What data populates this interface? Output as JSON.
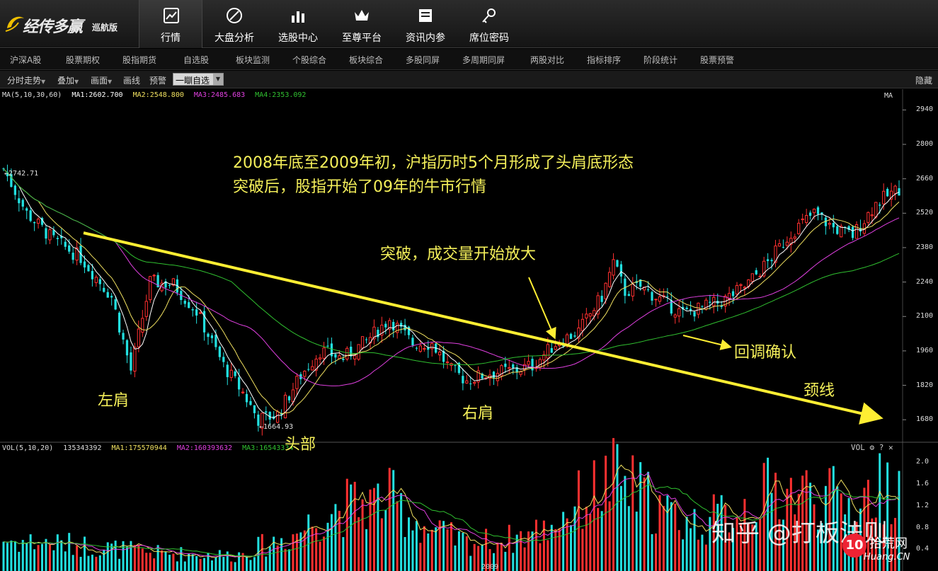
{
  "app": {
    "logo_name": "经传多赢",
    "logo_edition": "巡航版"
  },
  "nav": [
    {
      "label": "行情",
      "icon": "chart-trend-icon",
      "active": true
    },
    {
      "label": "大盘分析",
      "icon": "compass-icon",
      "active": false
    },
    {
      "label": "选股中心",
      "icon": "bar-chart-icon",
      "active": false
    },
    {
      "label": "至尊平台",
      "icon": "crown-icon",
      "active": false
    },
    {
      "label": "资讯内参",
      "icon": "news-icon",
      "active": false
    },
    {
      "label": "席位密码",
      "icon": "key-icon",
      "active": false
    }
  ],
  "menu": [
    "沪深A股",
    "股票期权",
    "股指期货",
    "自选股",
    "板块监测",
    "个股综合",
    "板块综合",
    "多股同屏",
    "多周期同屏",
    "两股对比",
    "指标排序",
    "阶段统计",
    "股票预警"
  ],
  "toolbar": {
    "intraday": "分时走势",
    "overlay": "叠加",
    "draw": "画面",
    "line": "画线",
    "alert": "预警",
    "combo_value": "一瞓自选",
    "hide": "隐藏"
  },
  "ma_legend": {
    "head": "MA(5,10,30,60)",
    "ma1": "MA1:2602.700",
    "ma2": "MA2:2548.800",
    "ma3": "MA3:2485.683",
    "ma4": "MA4:2353.092",
    "tag": "MA"
  },
  "vol_legend": {
    "head": "VOL(5,10,20)",
    "value": "135343392",
    "ma1": "MA1:175570944",
    "ma2": "MA2:160393632",
    "ma3": "MA3:16543334",
    "tools": "VOL ⚙ ? ✕"
  },
  "price_labels": {
    "high": "2742.71",
    "low": "1664.93"
  },
  "date_tick": "2009",
  "annotations": {
    "title1": "2008年底至2009年初，沪指历时5个月形成了头肩底形态",
    "title2": "突破后，股指开始了09年的牛市行情",
    "breakout": "突破，成交量开始放大",
    "left_shoulder": "左肩",
    "head": "头部",
    "right_shoulder": "右肩",
    "retest": "回调确认",
    "neckline": "颈线"
  },
  "watermark": "知乎 @打板法则",
  "brand": {
    "num": "10",
    "name": "拾荒网",
    "url": "Huang.CN"
  },
  "colors": {
    "up": "#ff3030",
    "down": "#22e0e0",
    "ma1": "#ffffff",
    "ma2": "#f0e060",
    "ma3": "#e040e0",
    "ma4": "#30c030",
    "annotation": "#f5f05a"
  },
  "chart_data": {
    "type": "candlestick",
    "price_axis": {
      "ticks": [
        2940,
        2800,
        2660,
        2520,
        2380,
        2240,
        2100,
        1960,
        1820,
        1680
      ],
      "range": [
        1600,
        2990
      ]
    },
    "volume_axis": {
      "ticks": [
        2.0,
        1.6,
        1.2,
        0.8,
        0.4
      ],
      "range": [
        0,
        2.2
      ]
    },
    "price_anchors": [
      [
        0,
        2700
      ],
      [
        6,
        2520
      ],
      [
        13,
        2410
      ],
      [
        20,
        2340
      ],
      [
        28,
        2180
      ],
      [
        33,
        1880
      ],
      [
        38,
        2240
      ],
      [
        44,
        2230
      ],
      [
        50,
        2120
      ],
      [
        57,
        1900
      ],
      [
        62,
        1790
      ],
      [
        66,
        1680
      ],
      [
        71,
        1700
      ],
      [
        77,
        1860
      ],
      [
        82,
        1960
      ],
      [
        88,
        1930
      ],
      [
        94,
        2000
      ],
      [
        100,
        2090
      ],
      [
        106,
        1990
      ],
      [
        111,
        1990
      ],
      [
        116,
        1880
      ],
      [
        120,
        1840
      ],
      [
        126,
        1870
      ],
      [
        132,
        1880
      ],
      [
        137,
        1900
      ],
      [
        143,
        1990
      ],
      [
        149,
        2040
      ],
      [
        155,
        2180
      ],
      [
        158,
        2320
      ],
      [
        161,
        2200
      ],
      [
        165,
        2220
      ],
      [
        171,
        2160
      ],
      [
        176,
        2110
      ],
      [
        180,
        2130
      ],
      [
        186,
        2160
      ],
      [
        192,
        2220
      ],
      [
        198,
        2320
      ],
      [
        204,
        2440
      ],
      [
        210,
        2520
      ],
      [
        215,
        2460
      ],
      [
        220,
        2430
      ],
      [
        226,
        2560
      ],
      [
        232,
        2620
      ]
    ],
    "volume_anchors": [
      [
        0,
        0.6
      ],
      [
        20,
        0.5
      ],
      [
        40,
        0.35
      ],
      [
        60,
        0.3
      ],
      [
        75,
        0.7
      ],
      [
        85,
        1.2
      ],
      [
        100,
        1.4
      ],
      [
        110,
        0.8
      ],
      [
        120,
        0.55
      ],
      [
        130,
        0.6
      ],
      [
        140,
        0.8
      ],
      [
        150,
        1.4
      ],
      [
        158,
        1.8
      ],
      [
        165,
        1.5
      ],
      [
        172,
        1.1
      ],
      [
        180,
        0.9
      ],
      [
        190,
        1.2
      ],
      [
        200,
        1.6
      ],
      [
        210,
        1.5
      ],
      [
        220,
        1.3
      ],
      [
        232,
        1.8
      ]
    ],
    "candle_count": 233,
    "neckline": {
      "from_price": 2440,
      "to_price": 1690
    }
  }
}
